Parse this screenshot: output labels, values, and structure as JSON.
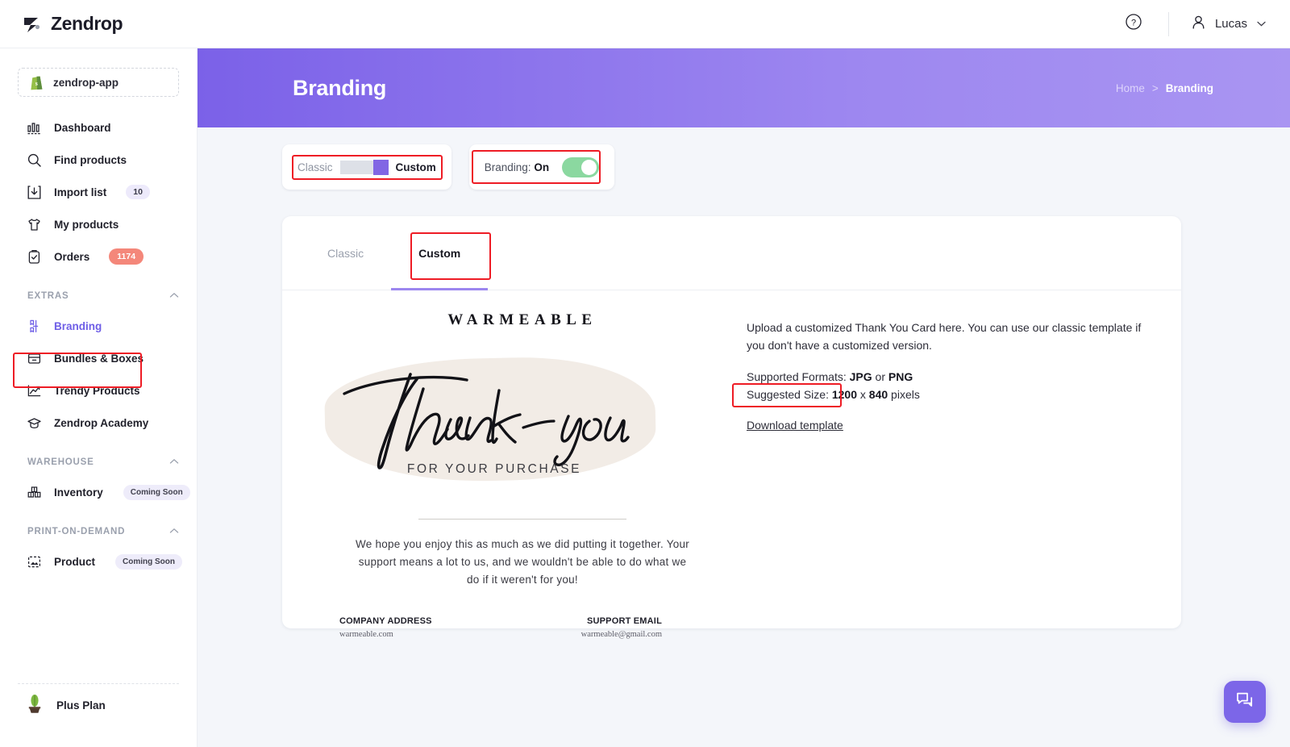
{
  "topbar": {
    "brand_name": "Zendrop",
    "help_icon": "question-circle-icon",
    "user_icon": "person-icon",
    "user_name": "Lucas",
    "caret": "⌄"
  },
  "sidebar": {
    "shop": {
      "name": "zendrop-app",
      "icon": "shopify-bag-icon"
    },
    "items": [
      {
        "label": "Dashboard",
        "icon": "bar-chart-icon"
      },
      {
        "label": "Find products",
        "icon": "search-icon"
      },
      {
        "label": "Import list",
        "icon": "download-box-icon",
        "badge": "10",
        "badge_style": "lavender"
      },
      {
        "label": "My products",
        "icon": "tshirt-icon"
      },
      {
        "label": "Orders",
        "icon": "clipboard-check-icon",
        "badge": "1174",
        "badge_style": "coral"
      }
    ],
    "sections": [
      {
        "title": "EXTRAS",
        "chevron": "chevron-up-icon",
        "items": [
          {
            "label": "Branding",
            "icon": "branding-icon",
            "active": true
          },
          {
            "label": "Bundles & Boxes",
            "icon": "box-icon"
          },
          {
            "label": "Trendy Products",
            "icon": "trend-line-icon"
          },
          {
            "label": "Zendrop Academy",
            "icon": "graduation-cap-icon"
          }
        ]
      },
      {
        "title": "WAREHOUSE",
        "chevron": "chevron-up-icon",
        "items": [
          {
            "label": "Inventory",
            "icon": "warehouse-boxes-icon",
            "badge": "Coming Soon",
            "badge_style": "soon"
          }
        ]
      },
      {
        "title": "PRINT-ON-DEMAND",
        "chevron": "chevron-up-icon",
        "items": [
          {
            "label": "Product",
            "icon": "image-frame-icon",
            "badge": "Coming Soon",
            "badge_style": "soon"
          }
        ]
      }
    ],
    "plan": {
      "label": "Plus Plan",
      "icon": "potted-plant-icon"
    }
  },
  "hero": {
    "title": "Branding",
    "breadcrumb_home": "Home",
    "breadcrumb_sep": ">",
    "breadcrumb_current": "Branding"
  },
  "controls": {
    "mode_switch": {
      "left_label": "Classic",
      "right_label": "Custom",
      "selected": "Custom"
    },
    "branding_toggle": {
      "prefix": "Branding:",
      "state": "On",
      "enabled": true
    }
  },
  "tabs": [
    {
      "label": "Classic",
      "active": false
    },
    {
      "label": "Custom",
      "active": true
    }
  ],
  "thank_you_card": {
    "brand": "WARMEABLE",
    "script_line": "Thank you",
    "subtitle": "FOR YOUR PURCHASE",
    "body": "We hope you enjoy this as much as we did putting it together. Your support means a lot to us, and we wouldn't be able to do what we do if it weren't for you!",
    "address_heading": "COMPANY ADDRESS",
    "address_value": "warmeable.com",
    "email_heading": "SUPPORT EMAIL",
    "email_value": "warmeable@gmail.com"
  },
  "upload_info": {
    "intro": "Upload a customized Thank You Card here. You can use our classic template if you don't have a customized version.",
    "formats_label": "Supported Formats:",
    "format_a": "JPG",
    "formats_or": "or",
    "format_b": "PNG",
    "size_label": "Suggested Size:",
    "size_w": "1200",
    "size_x": "x",
    "size_h": "840",
    "size_unit": "pixels",
    "download_link": "Download template"
  },
  "chat": {
    "icon": "chat-bubbles-icon"
  },
  "colors": {
    "accent_purple": "#7c66e8",
    "hero_gradient_start": "#7b61e8",
    "hero_gradient_end": "#a995f2",
    "toggle_green": "#8bd8a0",
    "badge_coral": "#f4877a",
    "highlight_red": "#ee1c25",
    "page_bg": "#f4f6fa",
    "card_beige": "#f2ece6"
  }
}
